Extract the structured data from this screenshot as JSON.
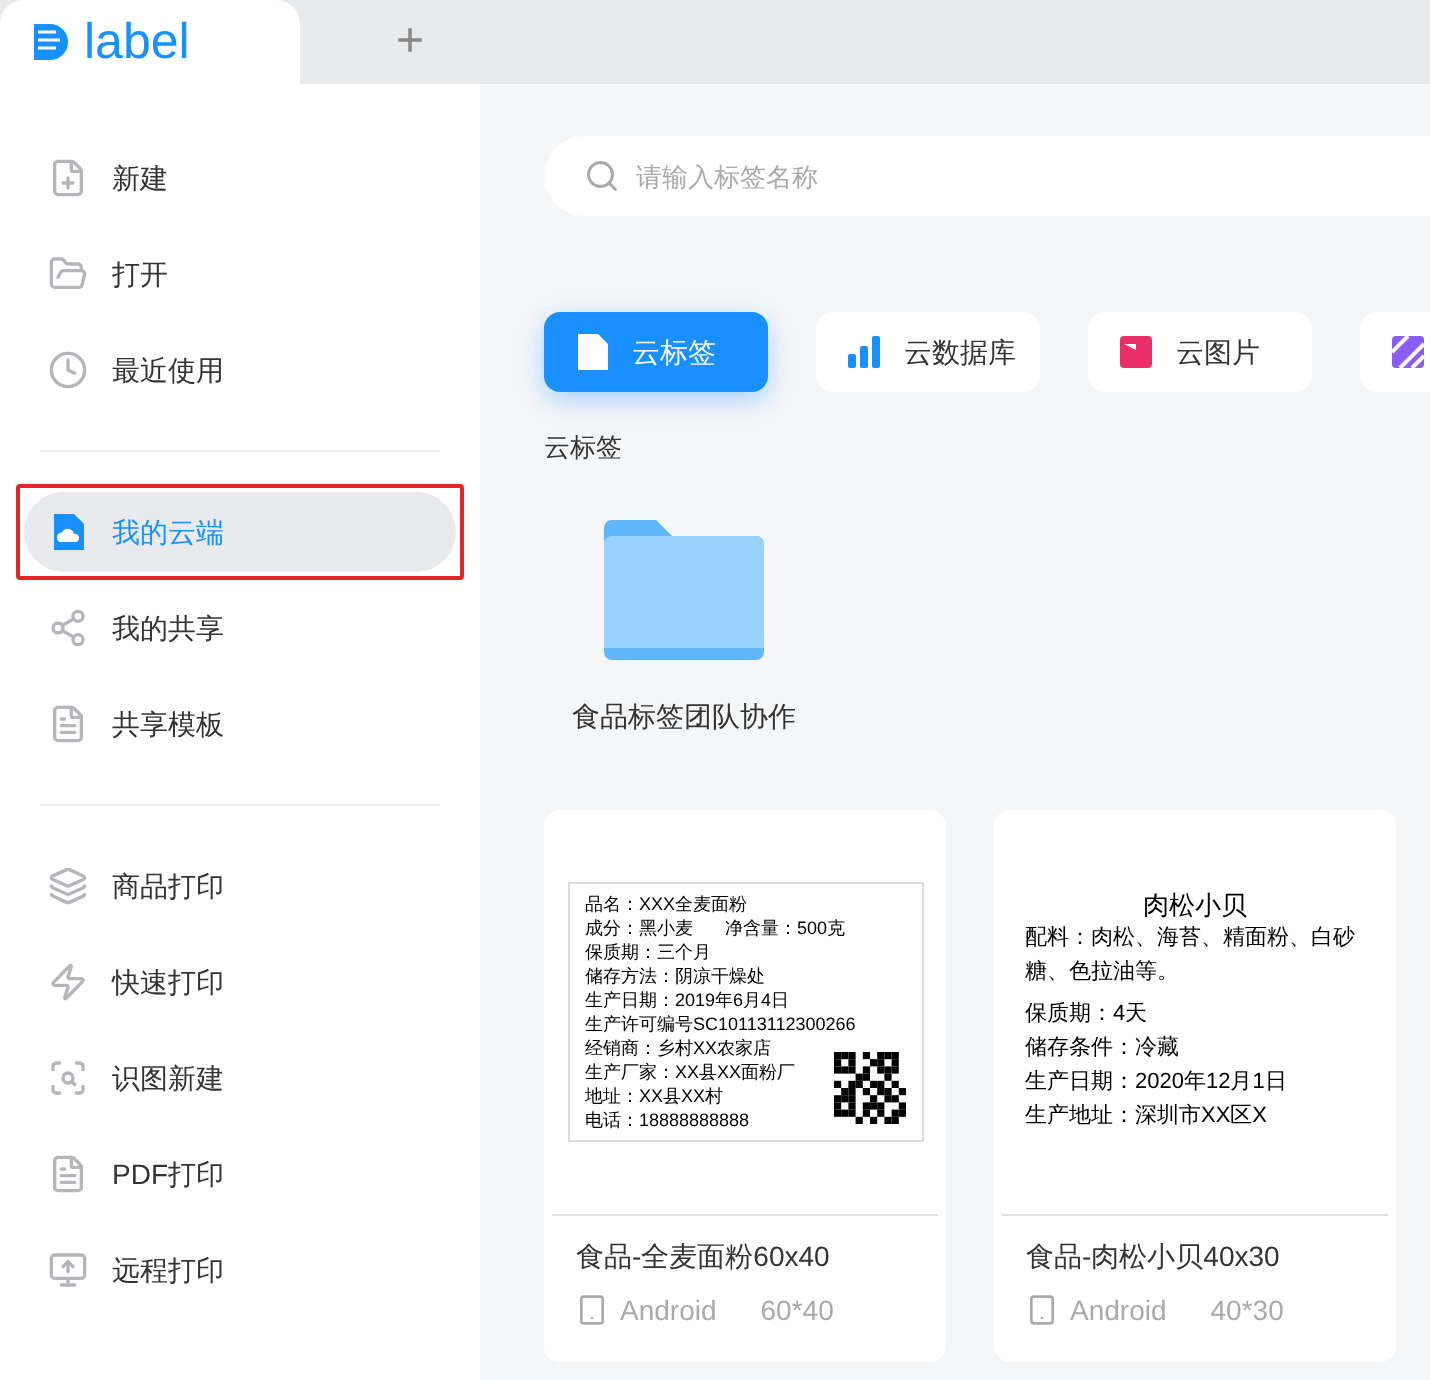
{
  "app_tabs": [
    {
      "kind": "logo",
      "label": "label",
      "selected": true
    },
    {
      "kind": "add",
      "label": "+",
      "selected": false
    }
  ],
  "sidebar": {
    "groups": [
      {
        "items": [
          {
            "label": "新建",
            "selected": false,
            "highlighted": false
          },
          {
            "label": "打开",
            "selected": false,
            "highlighted": false
          },
          {
            "label": "最近使用",
            "selected": false,
            "highlighted": false
          }
        ]
      },
      {
        "items": [
          {
            "label": "我的云端",
            "selected": true,
            "highlighted": true
          },
          {
            "label": "我的共享",
            "selected": false,
            "highlighted": false
          },
          {
            "label": "共享模板",
            "selected": false,
            "highlighted": false
          }
        ]
      },
      {
        "items": [
          {
            "label": "商品打印",
            "selected": false,
            "highlighted": false
          },
          {
            "label": "快速打印",
            "selected": false,
            "highlighted": false
          },
          {
            "label": "识图新建",
            "selected": false,
            "highlighted": false
          },
          {
            "label": "PDF打印",
            "selected": false,
            "highlighted": false
          },
          {
            "label": "远程打印",
            "selected": false,
            "highlighted": false
          }
        ]
      }
    ]
  },
  "search": {
    "placeholder": "请输入标签名称"
  },
  "category_tabs": [
    {
      "kind": "label",
      "label": "云标签",
      "selected": true
    },
    {
      "kind": "database",
      "label": "云数据库",
      "selected": false
    },
    {
      "kind": "image",
      "label": "云图片",
      "selected": false
    },
    {
      "kind": "pattern",
      "selected": false
    }
  ],
  "section_title": "云标签",
  "folders": [
    {
      "name": "食品标签团队协作"
    }
  ],
  "templates": [
    {
      "kind": "grid",
      "lines": [
        [
          "品名：XXX全麦面粉"
        ],
        [
          "成分：黑小麦",
          "净含量：500克"
        ],
        [
          "保质期：三个月"
        ],
        [
          "储存方法：阴凉干燥处"
        ],
        [
          "生产日期：2019年6月4日"
        ],
        [
          "生产许可编号SC10113112300266"
        ],
        [
          "经销商：乡村XX农家店"
        ],
        [
          "生产厂家：XX县XX面粉厂"
        ],
        [
          "地址：XX县XX村"
        ],
        [
          "电话：18888888888"
        ]
      ],
      "name": "食品-全麦面粉60x40",
      "platform": "Android",
      "size": "60*40"
    },
    {
      "kind": "titled",
      "heading": "肉松小贝",
      "lines": [
        [
          "配料：肉松、海苔、精面粉、白砂糖、色拉油等。"
        ],
        [
          "保质期：4天"
        ],
        [
          "储存条件：冷藏"
        ],
        [
          "生产日期：2020年12月1日"
        ],
        [
          "生产地址：深圳市XX区X"
        ]
      ],
      "name": "食品-肉松小贝40x30",
      "platform": "Android",
      "size": "40*30"
    }
  ]
}
